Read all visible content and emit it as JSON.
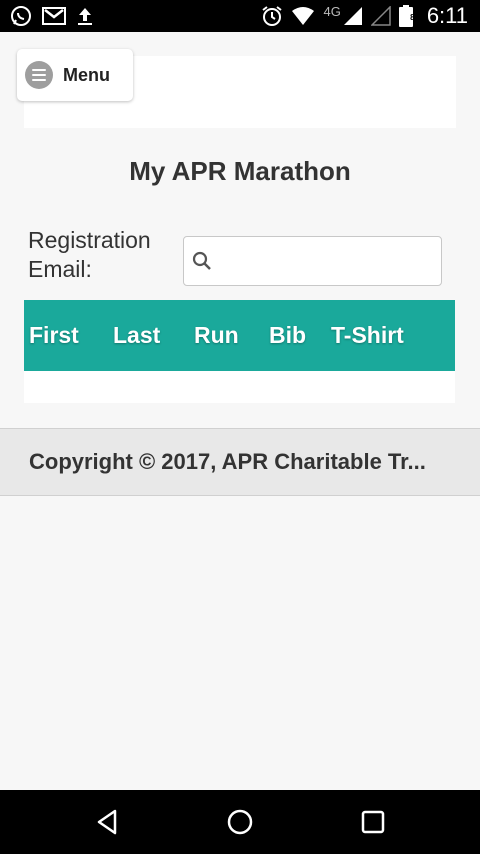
{
  "status_bar": {
    "network": "4G",
    "battery": "86",
    "time": "6:11",
    "left_icons": [
      "whatsapp-icon",
      "gmail-icon",
      "upload-icon"
    ],
    "right_icons": [
      "alarm-icon",
      "wifi-icon",
      "signal-icon",
      "signal-empty-icon",
      "battery-icon"
    ]
  },
  "menu": {
    "label": "Menu",
    "icon": "hamburger-icon"
  },
  "page": {
    "title": "My APR Marathon",
    "registration_label_line1": "Registration",
    "registration_label_line2": "Email:",
    "search_value": "",
    "search_icon": "search-icon"
  },
  "table": {
    "columns": [
      "First",
      "Last",
      "Run",
      "Bib",
      "T-Shirt"
    ],
    "header_color": "#1aa99b"
  },
  "footer": {
    "text": "Copyright © 2017, APR Charitable Tr..."
  },
  "nav_bar": {
    "buttons": [
      "back-icon",
      "home-icon",
      "recents-icon"
    ]
  }
}
